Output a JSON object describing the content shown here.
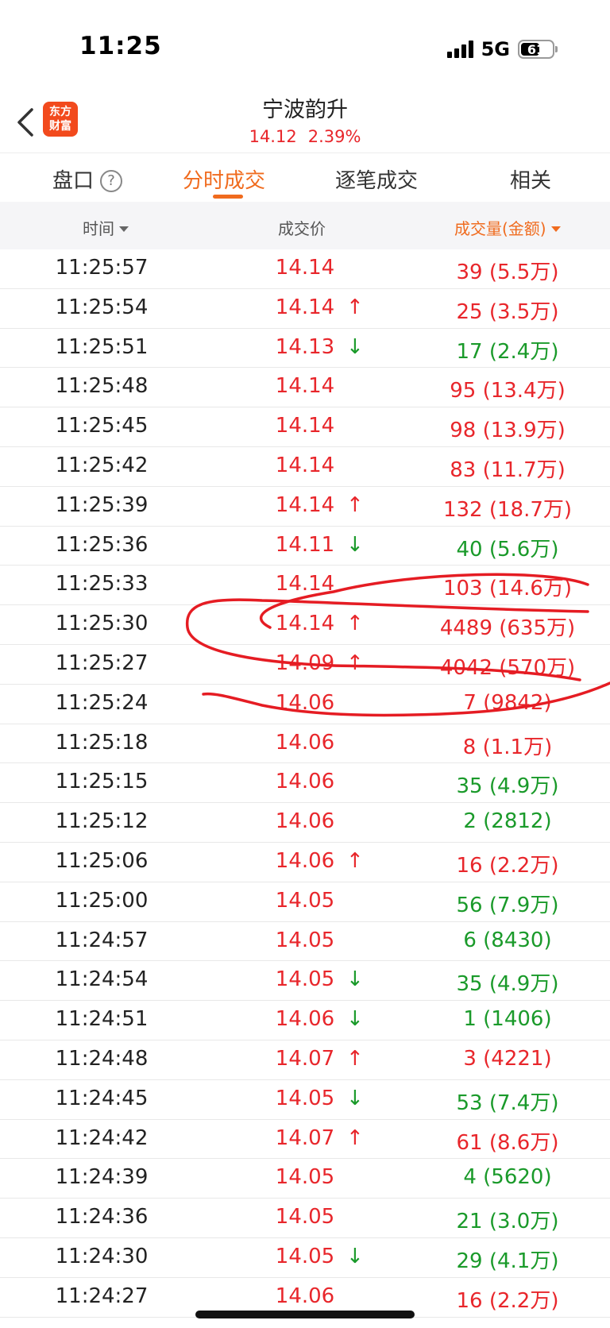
{
  "status_bar": {
    "time": "11:25",
    "network": "5G",
    "battery": "61",
    "battery_level": 0.61
  },
  "header": {
    "logo_line1": "东方",
    "logo_line2": "财富",
    "title": "宁波韵升",
    "price": "14.12",
    "change_pct": "2.39%"
  },
  "tabs": [
    {
      "label": "盘口",
      "active": false
    },
    {
      "label": "分时成交",
      "active": true
    },
    {
      "label": "逐笔成交",
      "active": false
    },
    {
      "label": "相关",
      "active": false
    }
  ],
  "columns": {
    "time": "时间",
    "price": "成交价",
    "volume": "成交量(金额)"
  },
  "colors": {
    "up": "#e8262b",
    "down": "#1a9a2a",
    "accent": "#f06b1e"
  },
  "trades": [
    {
      "time": "11:25:57",
      "price": "14.14",
      "arrow": "",
      "volume": "39 (5.5万)",
      "dir": "up"
    },
    {
      "time": "11:25:54",
      "price": "14.14",
      "arrow": "↑",
      "volume": "25 (3.5万)",
      "dir": "up"
    },
    {
      "time": "11:25:51",
      "price": "14.13",
      "arrow": "↓",
      "volume": "17 (2.4万)",
      "dir": "down"
    },
    {
      "time": "11:25:48",
      "price": "14.14",
      "arrow": "",
      "volume": "95 (13.4万)",
      "dir": "up"
    },
    {
      "time": "11:25:45",
      "price": "14.14",
      "arrow": "",
      "volume": "98 (13.9万)",
      "dir": "up"
    },
    {
      "time": "11:25:42",
      "price": "14.14",
      "arrow": "",
      "volume": "83 (11.7万)",
      "dir": "up"
    },
    {
      "time": "11:25:39",
      "price": "14.14",
      "arrow": "↑",
      "volume": "132 (18.7万)",
      "dir": "up"
    },
    {
      "time": "11:25:36",
      "price": "14.11",
      "arrow": "↓",
      "volume": "40 (5.6万)",
      "dir": "down"
    },
    {
      "time": "11:25:33",
      "price": "14.14",
      "arrow": "",
      "volume": "103 (14.6万)",
      "dir": "up"
    },
    {
      "time": "11:25:30",
      "price": "14.14",
      "arrow": "↑",
      "volume": "4489 (635万)",
      "dir": "up"
    },
    {
      "time": "11:25:27",
      "price": "14.09",
      "arrow": "↑",
      "volume": "4042 (570万)",
      "dir": "up"
    },
    {
      "time": "11:25:24",
      "price": "14.06",
      "arrow": "",
      "volume": "7 (9842)",
      "dir": "up"
    },
    {
      "time": "11:25:18",
      "price": "14.06",
      "arrow": "",
      "volume": "8 (1.1万)",
      "dir": "up"
    },
    {
      "time": "11:25:15",
      "price": "14.06",
      "arrow": "",
      "volume": "35 (4.9万)",
      "dir": "down"
    },
    {
      "time": "11:25:12",
      "price": "14.06",
      "arrow": "",
      "volume": "2 (2812)",
      "dir": "down"
    },
    {
      "time": "11:25:06",
      "price": "14.06",
      "arrow": "↑",
      "volume": "16 (2.2万)",
      "dir": "up"
    },
    {
      "time": "11:25:00",
      "price": "14.05",
      "arrow": "",
      "volume": "56 (7.9万)",
      "dir": "down"
    },
    {
      "time": "11:24:57",
      "price": "14.05",
      "arrow": "",
      "volume": "6 (8430)",
      "dir": "down"
    },
    {
      "time": "11:24:54",
      "price": "14.05",
      "arrow": "↓",
      "volume": "35 (4.9万)",
      "dir": "down"
    },
    {
      "time": "11:24:51",
      "price": "14.06",
      "arrow": "↓",
      "volume": "1 (1406)",
      "dir": "down"
    },
    {
      "time": "11:24:48",
      "price": "14.07",
      "arrow": "↑",
      "volume": "3 (4221)",
      "dir": "up"
    },
    {
      "time": "11:24:45",
      "price": "14.05",
      "arrow": "↓",
      "volume": "53 (7.4万)",
      "dir": "down"
    },
    {
      "time": "11:24:42",
      "price": "14.07",
      "arrow": "↑",
      "volume": "61 (8.6万)",
      "dir": "up"
    },
    {
      "time": "11:24:39",
      "price": "14.05",
      "arrow": "",
      "volume": "4 (5620)",
      "dir": "down"
    },
    {
      "time": "11:24:36",
      "price": "14.05",
      "arrow": "",
      "volume": "21 (3.0万)",
      "dir": "down"
    },
    {
      "time": "11:24:30",
      "price": "14.05",
      "arrow": "↓",
      "volume": "29 (4.1万)",
      "dir": "down"
    },
    {
      "time": "11:24:27",
      "price": "14.06",
      "arrow": "",
      "volume": "16 (2.2万)",
      "dir": "up"
    }
  ]
}
